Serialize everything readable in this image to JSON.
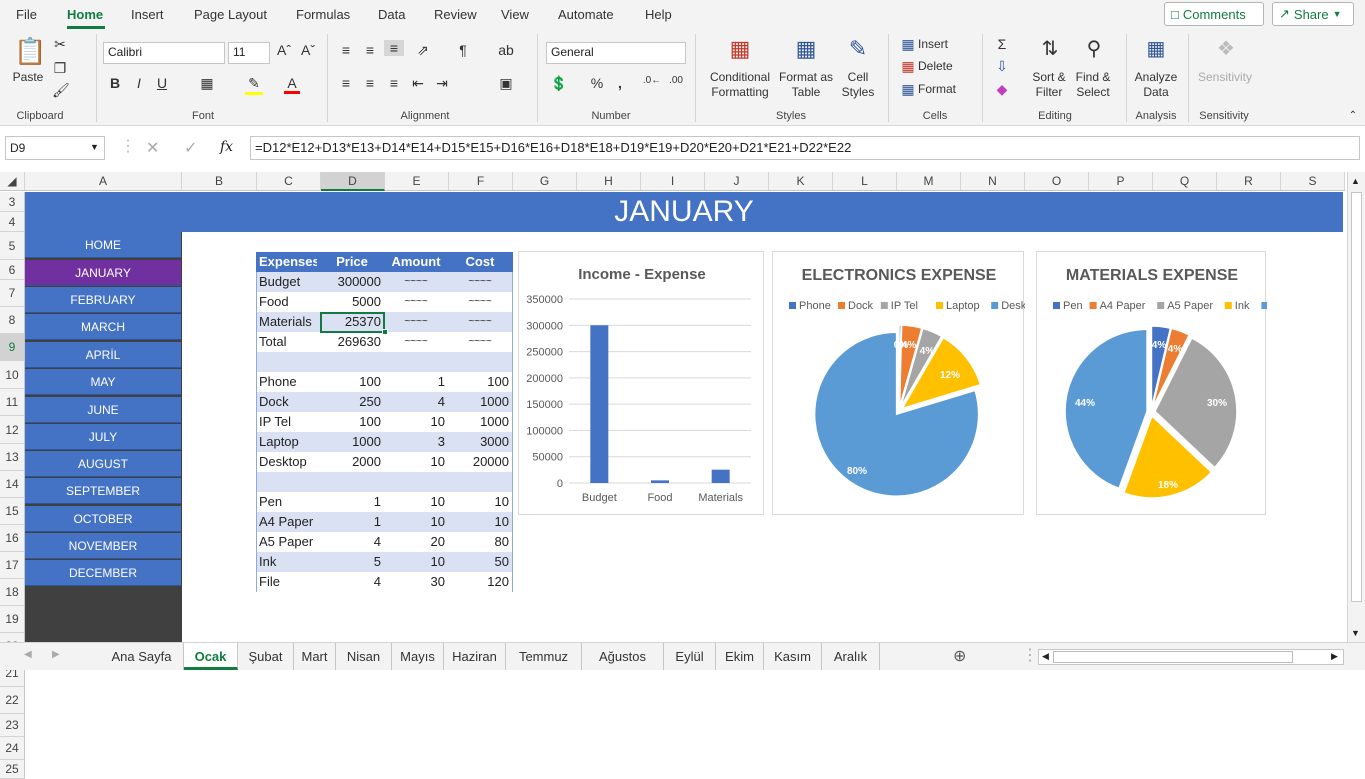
{
  "menubar": {
    "tabs": [
      "File",
      "Home",
      "Insert",
      "Page Layout",
      "Formulas",
      "Data",
      "Review",
      "View",
      "Automate",
      "Help"
    ],
    "comments_label": "Comments",
    "share_label": "Share"
  },
  "ribbon": {
    "clipboard": {
      "paste": "Paste",
      "label": "Clipboard"
    },
    "font": {
      "name": "Calibri",
      "size": "11",
      "label": "Font"
    },
    "alignment": {
      "label": "Alignment"
    },
    "number": {
      "format": "General",
      "label": "Number"
    },
    "styles": {
      "conditional": "Conditional\nFormatting",
      "format_table": "Format as\nTable",
      "cell_styles": "Cell\nStyles",
      "label": "Styles"
    },
    "cells": {
      "insert": "Insert",
      "delete": "Delete",
      "format": "Format",
      "label": "Cells"
    },
    "editing": {
      "sort": "Sort &\nFilter",
      "find": "Find &\nSelect",
      "label": "Editing"
    },
    "analysis": {
      "analyze": "Analyze\nData",
      "label": "Analysis"
    },
    "sensitivity": {
      "btn": "Sensitivity",
      "label": "Sensitivity"
    }
  },
  "formula_bar": {
    "name_box": "D9",
    "fx": "fx",
    "formula": "=D12*E12+D13*E13+D14*E14+D15*E15+D16*E16+D18*E18+D19*E19+D20*E20+D21*E21+D22*E22"
  },
  "columns": [
    "A",
    "B",
    "C",
    "D",
    "E",
    "F",
    "G",
    "H",
    "I",
    "J",
    "K",
    "L",
    "M",
    "N",
    "O",
    "P",
    "Q",
    "R",
    "S"
  ],
  "rows": [
    "3",
    "4",
    "5",
    "6",
    "7",
    "8",
    "9",
    "10",
    "11",
    "12",
    "13",
    "14",
    "15",
    "16",
    "17",
    "18",
    "19",
    "20",
    "21",
    "22",
    "23",
    "24",
    "25"
  ],
  "banner_title": "JANUARY",
  "nav": [
    "HOME",
    "JANUARY",
    "FEBRUARY",
    "MARCH",
    "APRİL",
    "MAY",
    "JUNE",
    "JULY",
    "AUGUST",
    "SEPTEMBER",
    "OCTOBER",
    "NOVEMBER",
    "DECEMBER"
  ],
  "table": {
    "headers": [
      "Expenses",
      "Price",
      "Amount",
      "Cost"
    ],
    "rows": [
      [
        "Budget",
        "300000",
        "~~~~",
        "~~~~"
      ],
      [
        "Food",
        "5000",
        "~~~~",
        "~~~~"
      ],
      [
        "Materials",
        "25370",
        "~~~~",
        "~~~~"
      ],
      [
        "Total",
        "269630",
        "~~~~",
        "~~~~"
      ],
      [
        "",
        "",
        "",
        ""
      ],
      [
        "Phone",
        "100",
        "1",
        "100"
      ],
      [
        "Dock",
        "250",
        "4",
        "1000"
      ],
      [
        "IP Tel",
        "100",
        "10",
        "1000"
      ],
      [
        "Laptop",
        "1000",
        "3",
        "3000"
      ],
      [
        "Desktop",
        "2000",
        "10",
        "20000"
      ],
      [
        "",
        "",
        "",
        ""
      ],
      [
        "Pen",
        "1",
        "10",
        "10"
      ],
      [
        "A4 Paper",
        "1",
        "10",
        "10"
      ],
      [
        "A5 Paper",
        "4",
        "20",
        "80"
      ],
      [
        "Ink",
        "5",
        "10",
        "50"
      ],
      [
        "File",
        "4",
        "30",
        "120"
      ]
    ]
  },
  "chart_data": [
    {
      "type": "bar",
      "title": "Income - Expense",
      "categories": [
        "Budget",
        "Food",
        "Materials"
      ],
      "values": [
        300000,
        5000,
        25370
      ],
      "ylim": [
        0,
        350000
      ],
      "yticks": [
        "350000",
        "300000",
        "250000",
        "200000",
        "150000",
        "100000",
        "50000",
        "0"
      ],
      "color": "#4472c4"
    },
    {
      "type": "pie",
      "title": "ELECTRONICS EXPENSE",
      "categories": [
        "Phone",
        "Dock",
        "IP Tel",
        "Laptop",
        "Desktop"
      ],
      "values": [
        100,
        1000,
        1000,
        3000,
        20000
      ],
      "labels": [
        "0%",
        "4%",
        "4%",
        "12%",
        "80%"
      ],
      "colors": [
        "#4472c4",
        "#ed7d31",
        "#a5a5a5",
        "#ffc000",
        "#5b9bd5"
      ],
      "legend": "top"
    },
    {
      "type": "pie",
      "title": "MATERIALS EXPENSE",
      "categories": [
        "Pen",
        "A4 Paper",
        "A5 Paper",
        "Ink",
        "File"
      ],
      "values": [
        10,
        10,
        80,
        50,
        120
      ],
      "labels": [
        "4%",
        "4%",
        "30%",
        "18%",
        "44%"
      ],
      "colors": [
        "#4472c4",
        "#ed7d31",
        "#a5a5a5",
        "#ffc000",
        "#5b9bd5"
      ],
      "legend": "top"
    }
  ],
  "sheet_tabs": [
    "Ana Sayfa",
    "Ocak",
    "Şubat",
    "Mart",
    "Nisan",
    "Mayıs",
    "Haziran",
    "Temmuz",
    "Ağustos",
    "Eylül",
    "Ekim",
    "Kasım",
    "Aralık"
  ],
  "active_sheet": "Ocak",
  "colors": {
    "accent": "#107c41",
    "nav": "#4472c4",
    "nav_current": "#7030a0",
    "table_band": "#d9e1f2"
  }
}
